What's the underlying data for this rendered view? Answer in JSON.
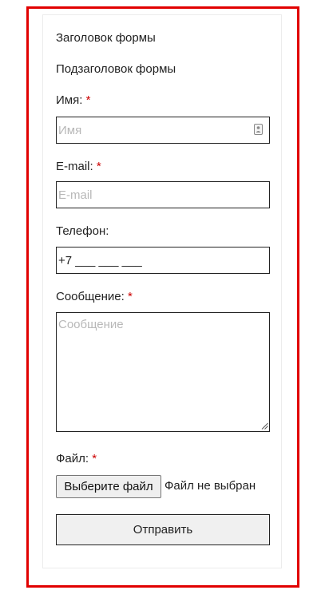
{
  "form": {
    "title": "Заголовок формы",
    "subtitle": "Подзаголовок формы",
    "required_mark": "*",
    "name": {
      "label": "Имя:",
      "placeholder": "Имя",
      "icon": "contact-card-icon"
    },
    "email": {
      "label": "E-mail:",
      "placeholder": "E-mail"
    },
    "phone": {
      "label": "Телефон:",
      "value": "+7 ___ ___ ___"
    },
    "message": {
      "label": "Сообщение:",
      "placeholder": "Сообщение"
    },
    "file": {
      "label": "Файл:",
      "button_label": "Выберите файл",
      "status": "Файл не выбран"
    },
    "submit_label": "Отправить"
  },
  "colors": {
    "frame_border": "#e10000",
    "required": "#cc0000",
    "card_border": "#ececec",
    "placeholder": "#b8b8b8",
    "button_bg": "#f0f0f0"
  }
}
